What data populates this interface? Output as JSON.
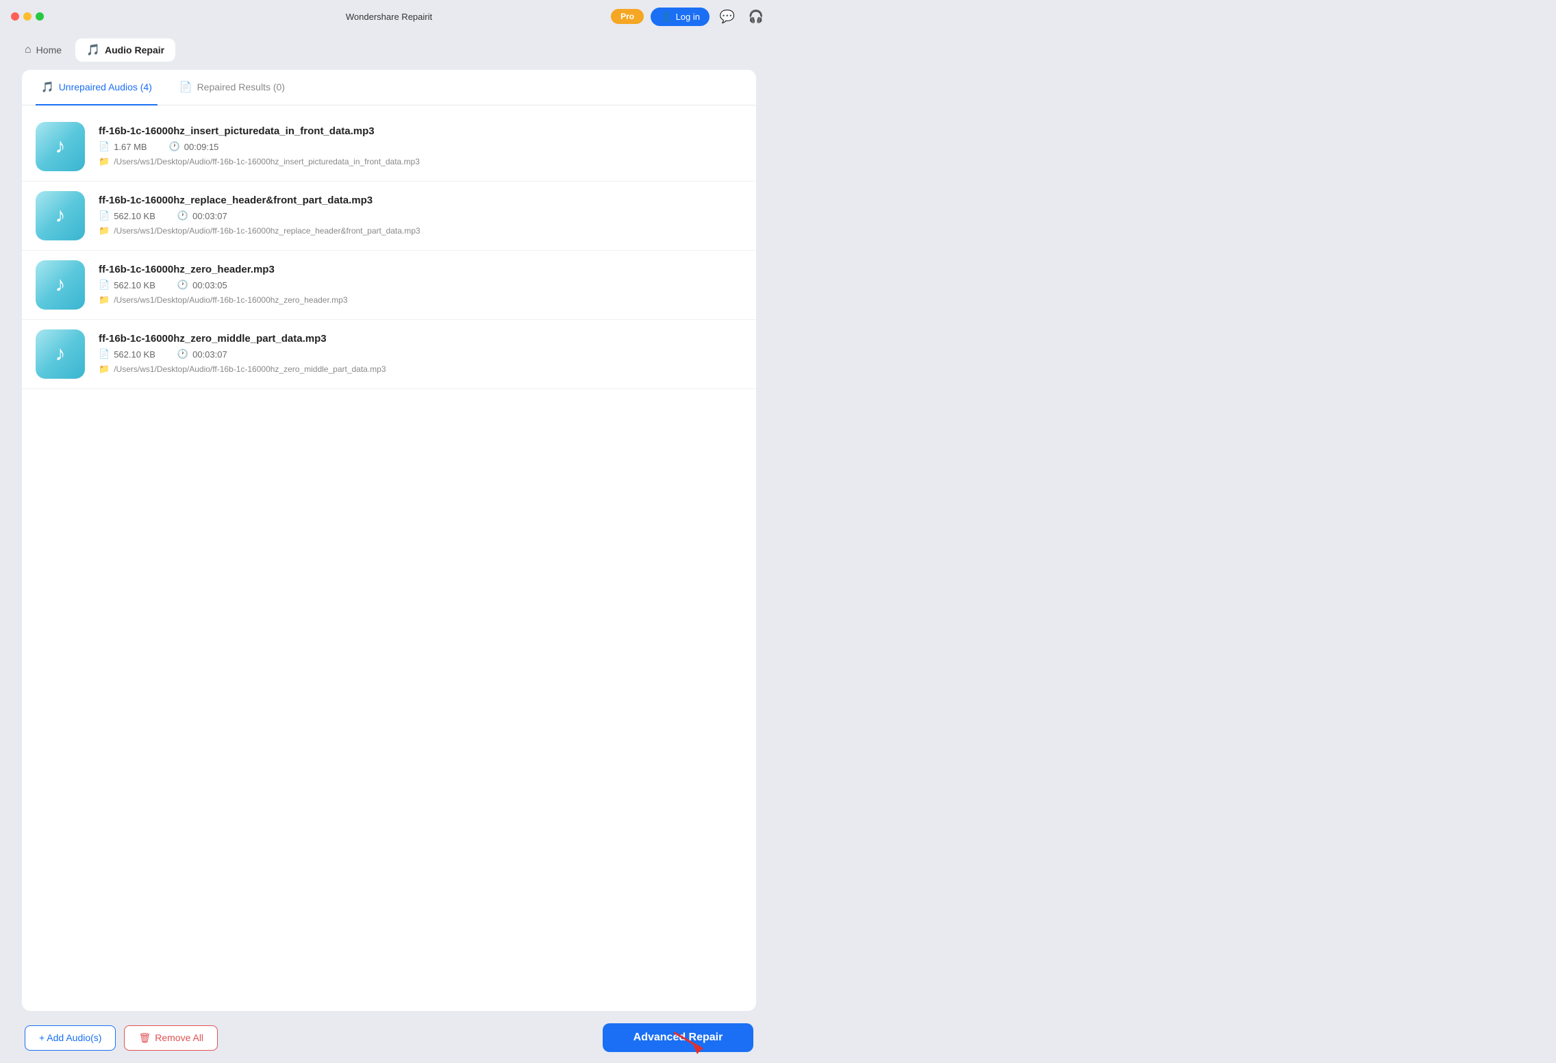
{
  "titleBar": {
    "appTitle": "Wondershare Repairit",
    "proBadge": "Pro",
    "loginLabel": "Log in"
  },
  "nav": {
    "homeLabel": "Home",
    "audioRepairLabel": "Audio Repair"
  },
  "tabs": {
    "unrepairedLabel": "Unrepaired Audios (4)",
    "repairedLabel": "Repaired Results (0)"
  },
  "files": [
    {
      "name": "ff-16b-1c-16000hz_insert_picturedata_in_front_data.mp3",
      "size": "1.67 MB",
      "duration": "00:09:15",
      "path": "/Users/ws1/Desktop/Audio/ff-16b-1c-16000hz_insert_picturedata_in_front_data.mp3"
    },
    {
      "name": "ff-16b-1c-16000hz_replace_header&front_part_data.mp3",
      "size": "562.10 KB",
      "duration": "00:03:07",
      "path": "/Users/ws1/Desktop/Audio/ff-16b-1c-16000hz_replace_header&front_part_data.mp3"
    },
    {
      "name": "ff-16b-1c-16000hz_zero_header.mp3",
      "size": "562.10 KB",
      "duration": "00:03:05",
      "path": "/Users/ws1/Desktop/Audio/ff-16b-1c-16000hz_zero_header.mp3"
    },
    {
      "name": "ff-16b-1c-16000hz_zero_middle_part_data.mp3",
      "size": "562.10 KB",
      "duration": "00:03:07",
      "path": "/Users/ws1/Desktop/Audio/ff-16b-1c-16000hz_zero_middle_part_data.mp3"
    }
  ],
  "buttons": {
    "addAudio": "+ Add Audio(s)",
    "removeAll": "Remove All",
    "advancedRepair": "Advanced Repair"
  },
  "icons": {
    "musicNote": "♪",
    "fileIcon": "📄",
    "clockIcon": "🕐",
    "folderIcon": "📁",
    "userIcon": "👤",
    "homeIcon": "⌂",
    "audioIcon": "🎵",
    "chatIcon": "💬",
    "headphoneIcon": "🎧",
    "trashIcon": "🗑"
  }
}
